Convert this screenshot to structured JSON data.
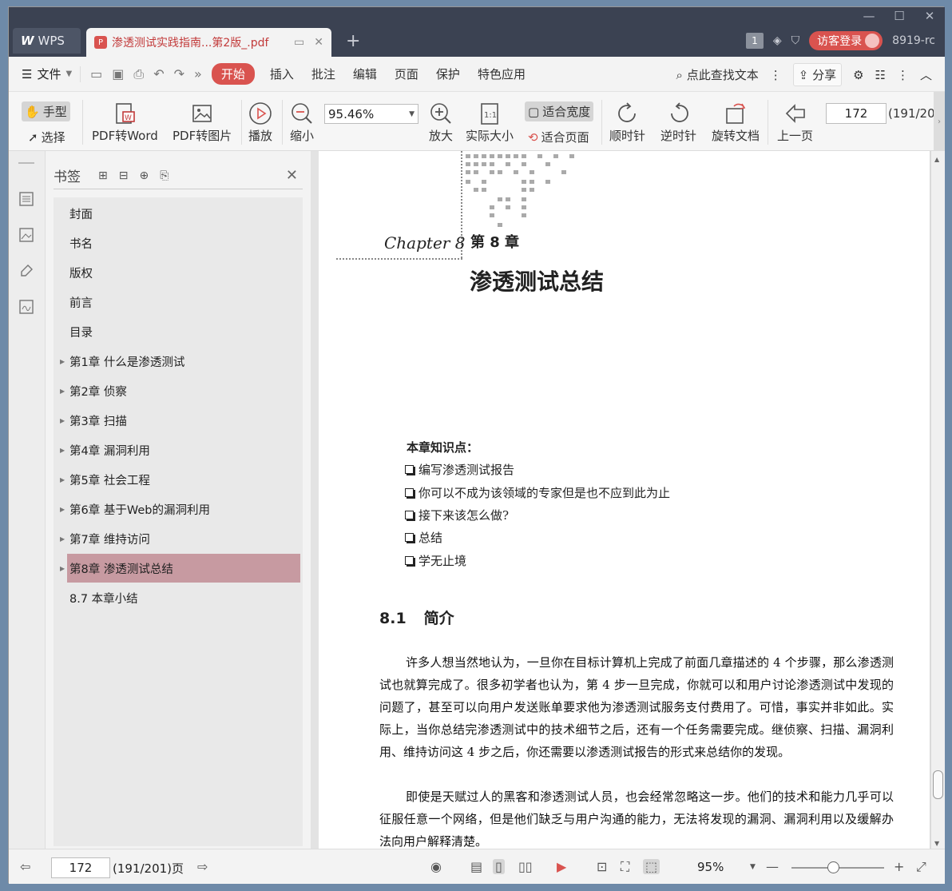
{
  "window": {
    "controls": [
      "—",
      "☐",
      "✕"
    ],
    "tabs": {
      "home_label": "WPS",
      "doc_label": "渗透测试实践指南...第2版_.pdf",
      "add": "+"
    },
    "right": {
      "page_badge": "1",
      "login_label": "访客登录",
      "version": "8919-rc"
    }
  },
  "menubar": {
    "file_label": "文件",
    "items": [
      "开始",
      "插入",
      "批注",
      "编辑",
      "页面",
      "保护",
      "特色应用"
    ],
    "search_label": "点此查找文本",
    "share_label": "分享"
  },
  "toolbar": {
    "hand_label": "手型",
    "select_label": "选择",
    "pdf2word_label": "PDF转Word",
    "pdf2img_label": "PDF转图片",
    "play_label": "播放",
    "zoomout_label": "缩小",
    "zoom_value": "95.46%",
    "zoomin_label": "放大",
    "actual_label": "实际大小",
    "fitwidth_label": "适合宽度",
    "fitpage_label": "适合页面",
    "cw_label": "顺时针",
    "ccw_label": "逆时针",
    "rotate_label": "旋转文档",
    "prev_label": "上一页",
    "page_value": "172",
    "page_total": "(191/20"
  },
  "panel": {
    "title": "书签",
    "bookmarks": [
      {
        "label": "封面",
        "expandable": false
      },
      {
        "label": "书名",
        "expandable": false
      },
      {
        "label": "版权",
        "expandable": false
      },
      {
        "label": "前言",
        "expandable": false
      },
      {
        "label": "目录",
        "expandable": false
      },
      {
        "label": "第1章  什么是渗透测试",
        "expandable": true
      },
      {
        "label": "第2章  侦察",
        "expandable": true
      },
      {
        "label": "第3章  扫描",
        "expandable": true
      },
      {
        "label": "第4章  漏洞利用",
        "expandable": true
      },
      {
        "label": "第5章  社会工程",
        "expandable": true
      },
      {
        "label": "第6章  基于Web的漏洞利用",
        "expandable": true
      },
      {
        "label": "第7章  维持访问",
        "expandable": true
      },
      {
        "label": "第8章  渗透测试总结",
        "expandable": true,
        "selected": true
      },
      {
        "label": "8.7  本章小结",
        "expandable": false
      }
    ]
  },
  "document": {
    "chapter_script": "Chapter 8",
    "chapter_number": "第 8 章",
    "chapter_title": "渗透测试总结",
    "knowledge_title": "本章知识点：",
    "knowledge_items": [
      "编写渗透测试报告",
      "你可以不成为该领域的专家但是也不应到此为止",
      "接下来该怎么做?",
      "总结",
      "学无止境"
    ],
    "section_number": "8.1",
    "section_title": "简介",
    "paragraphs": [
      "许多人想当然地认为，一旦你在目标计算机上完成了前面几章描述的 4 个步骤，那么渗透测试也就算完成了。很多初学者也认为，第 4 步一旦完成，你就可以和用户讨论渗透测试中发现的问题了，甚至可以向用户发送账单要求他为渗透测试服务支付费用了。可惜，事实并非如此。实际上，当你总结完渗透测试中的技术细节之后，还有一个任务需要完成。继侦察、扫描、漏洞利用、维持访问这 4 步之后，你还需要以渗透测试报告的形式来总结你的发现。",
      "即使是天赋过人的黑客和渗透测试人员，也会经常忽略这一步。他们的技术和能力几乎可以征服任意一个网络，但是他们缺乏与用户沟通的能力，无法将发现的漏洞、漏洞利用以及缓解办法向用户解释清楚。"
    ]
  },
  "statusbar": {
    "page_value": "172",
    "page_text": "(191/201)页",
    "zoom_value": "95%"
  },
  "colors": {
    "accent": "#d9534f",
    "selected_bookmark": "#c79aa1",
    "titlebar": "#3b4252"
  }
}
